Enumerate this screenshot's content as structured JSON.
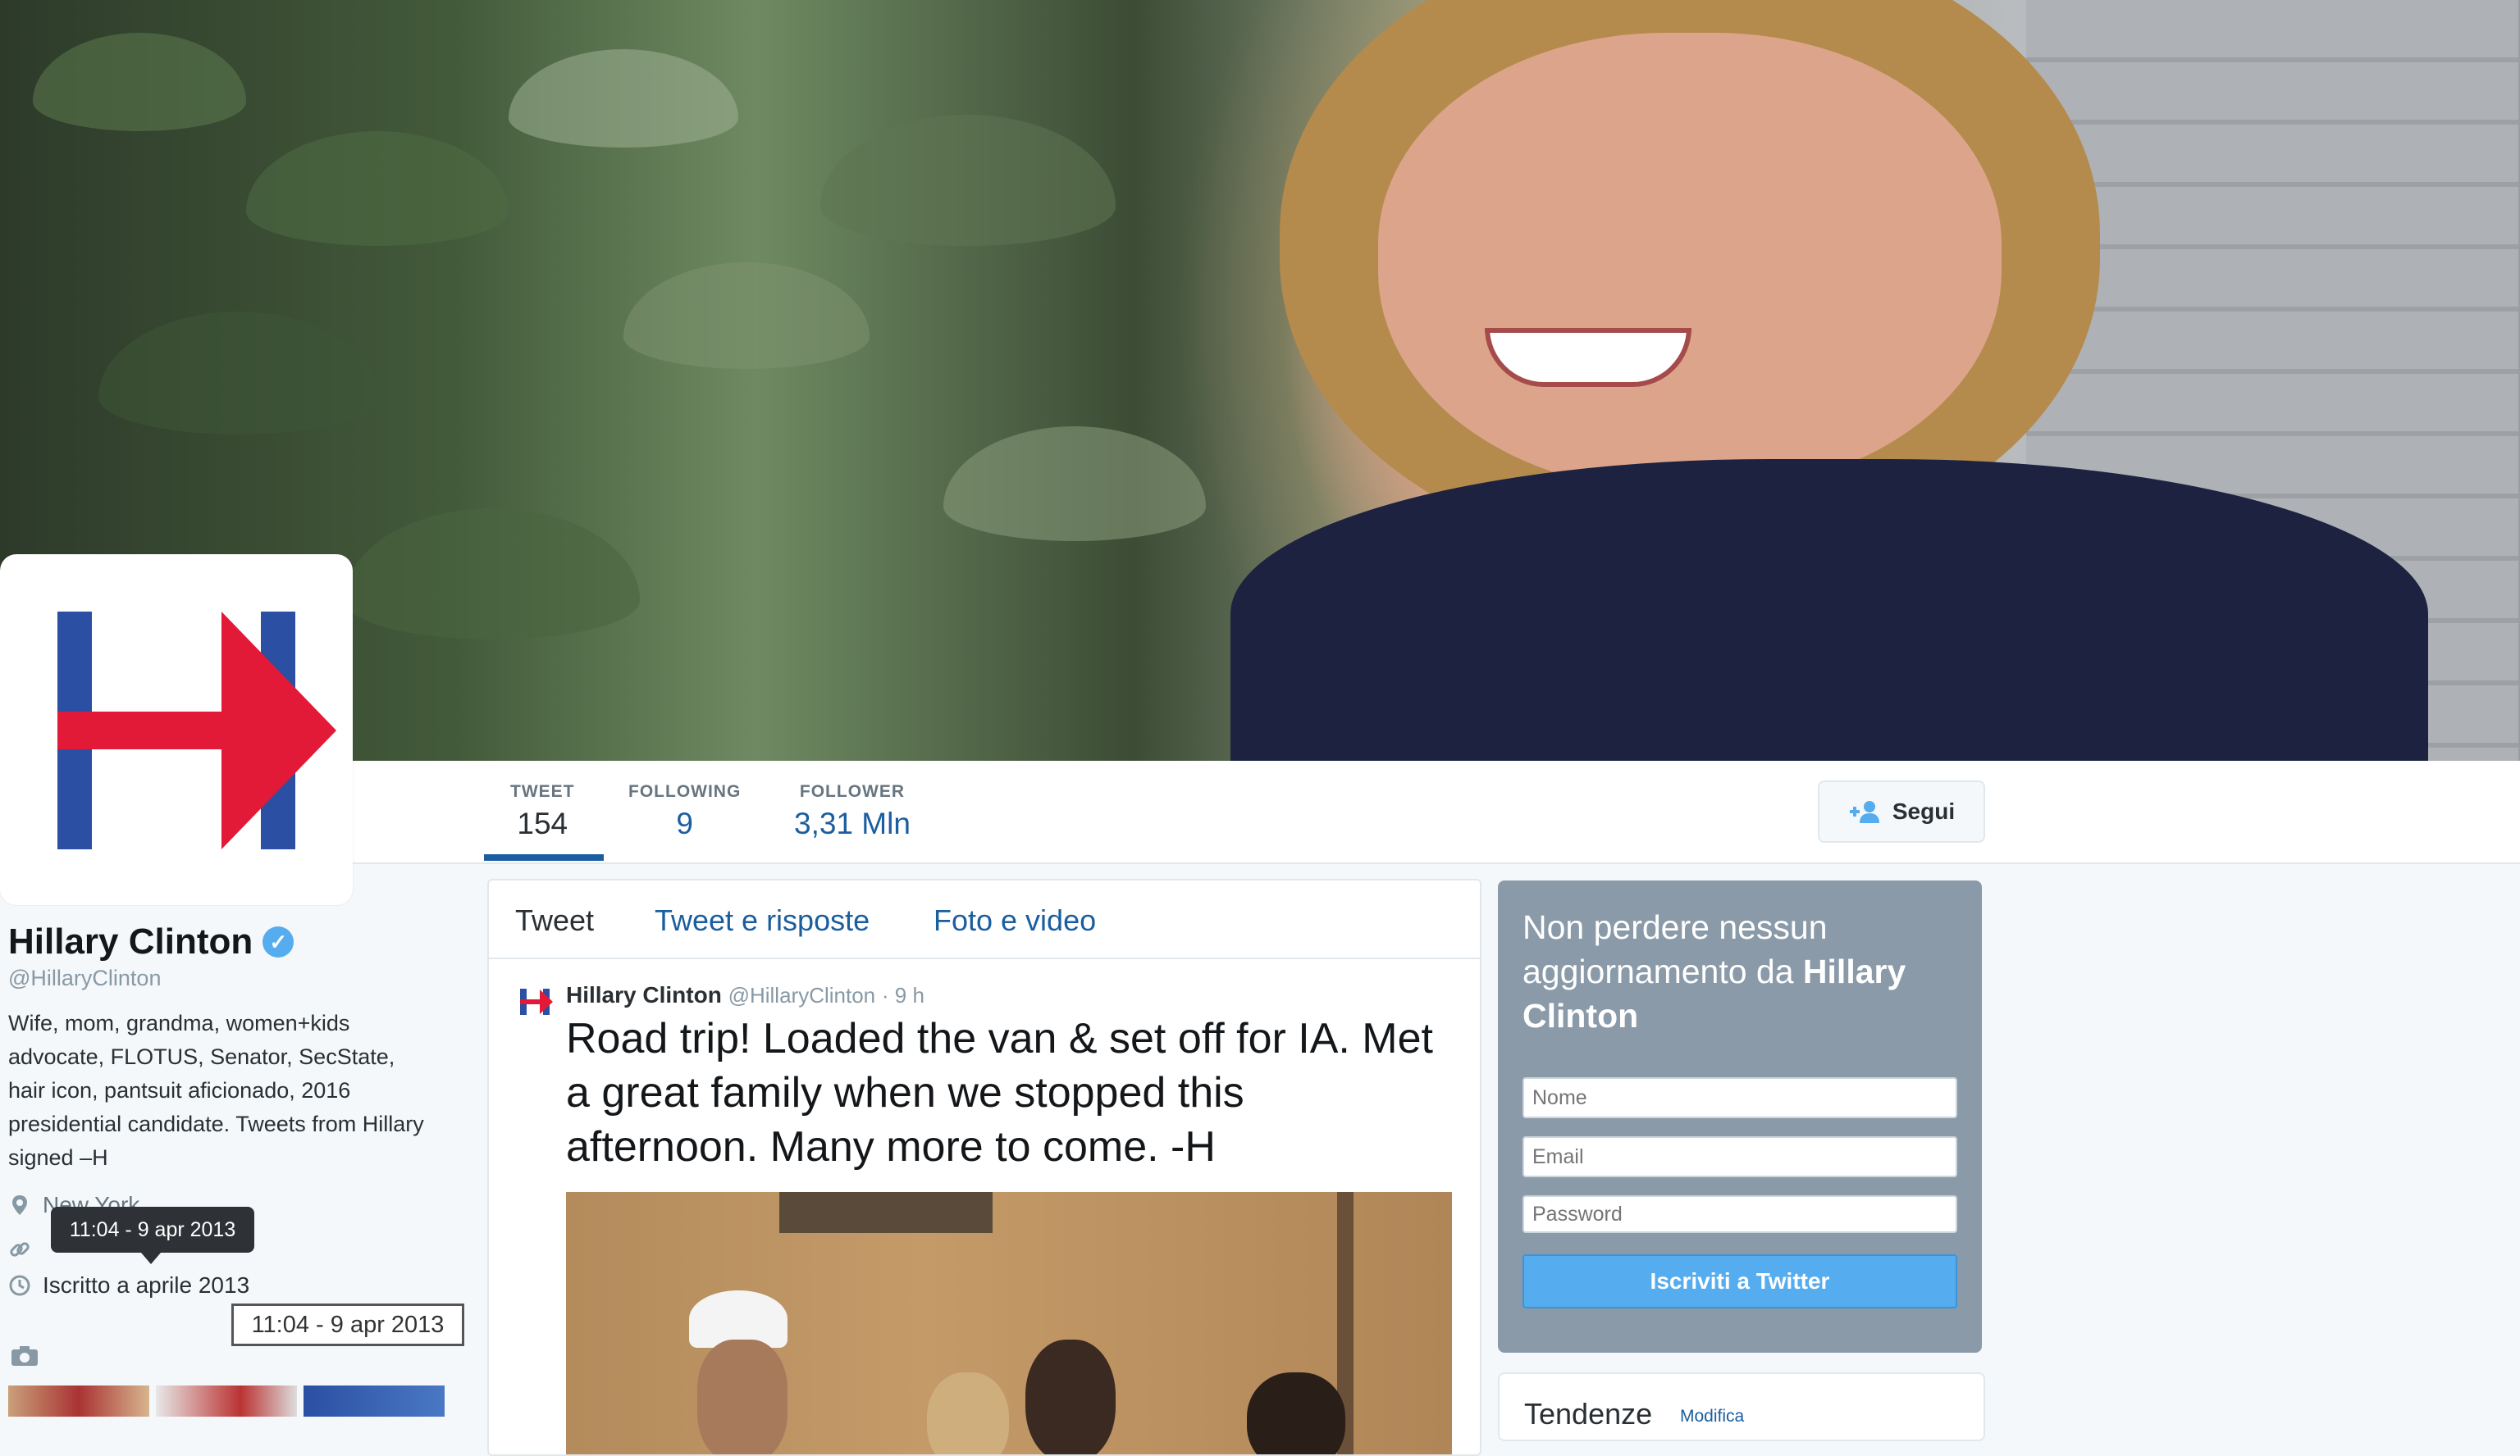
{
  "profile": {
    "name": "Hillary Clinton",
    "handle": "@HillaryClinton",
    "bio": "Wife, mom, grandma, women+kids advocate, FLOTUS, Senator, SecState, hair icon, pantsuit aficionado, 2016 presidential candidate. Tweets from Hillary signed –H",
    "location": "New York",
    "joined": "Iscritto a aprile 2013"
  },
  "stats": [
    {
      "label": "TWEET",
      "value": "154"
    },
    {
      "label": "FOLLOWING",
      "value": "9"
    },
    {
      "label": "FOLLOWER",
      "value": "3,31 Mln"
    }
  ],
  "follow_button": {
    "label": "Segui"
  },
  "tooltips": {
    "dark": "11:04 - 9 apr 2013",
    "light": "11:04 - 9 apr 2013"
  },
  "timeline": {
    "tabs": [
      "Tweet",
      "Tweet e risposte",
      "Foto e video"
    ],
    "tweet": {
      "author": "Hillary Clinton",
      "handle": "@HillaryClinton",
      "time": "· 9 h",
      "text": "Road trip! Loaded the van & set off for IA. Met a great family when we stopped this afternoon. Many more to come. -H"
    }
  },
  "signup": {
    "title_prefix": "Non perdere nessun aggiornamento da ",
    "title_name": "Hillary Clinton",
    "name_placeholder": "Nome",
    "email_placeholder": "Email",
    "password_placeholder": "Password",
    "button": "Iscriviti a Twitter"
  },
  "trends": {
    "title": "Tendenze",
    "edit": "Modifica"
  },
  "colors": {
    "link": "#1b5ea0",
    "logo_blue": "#2a4fa3",
    "logo_red": "#e21a37"
  }
}
